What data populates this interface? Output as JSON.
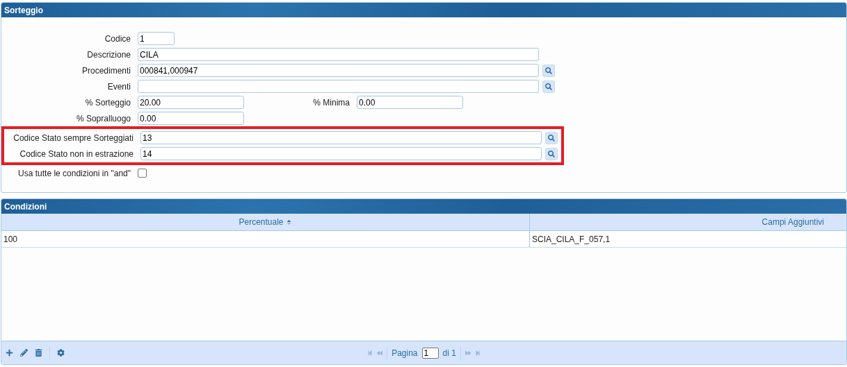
{
  "form_panel": {
    "title": "Sorteggio",
    "rows": [
      {
        "kind": "field",
        "fields": [
          {
            "kind": "short",
            "label": "Codice",
            "value": "1"
          }
        ]
      },
      {
        "kind": "field",
        "fields": [
          {
            "kind": "wide",
            "label": "Descrizione",
            "value": "CILA"
          }
        ]
      },
      {
        "kind": "field",
        "fields": [
          {
            "kind": "lookup",
            "label": "Procedimenti",
            "value": "000841,000947"
          }
        ]
      },
      {
        "kind": "field",
        "fields": [
          {
            "kind": "lookup",
            "label": "Eventi"
          }
        ]
      },
      {
        "kind": "field",
        "fields": [
          {
            "kind": "medium",
            "label": "% Sorteggio",
            "value": "20.00"
          },
          {
            "kind": "medium",
            "label": "% Minima",
            "value": "0.00"
          }
        ]
      },
      {
        "kind": "field",
        "fields": [
          {
            "kind": "medium",
            "label": "% Sopralluogo",
            "value": "0.00"
          }
        ]
      },
      {
        "kind": "highlight",
        "rows": [
          {
            "kind": "field",
            "fields": [
              {
                "kind": "lookup",
                "label": "Codice Stato sempre Sorteggiati",
                "value": "13"
              }
            ]
          },
          {
            "kind": "field",
            "fields": [
              {
                "kind": "lookup",
                "label": "Codice Stato non in estrazione",
                "value": "14"
              }
            ]
          }
        ]
      },
      {
        "kind": "checkbox",
        "label": "Usa tutte le condizioni in \"and\"",
        "checked": false
      }
    ]
  },
  "grid_panel": {
    "title": "Condizioni",
    "columns": [
      {
        "label": "Percentuale",
        "sorted": true
      },
      {
        "label": "Campi Aggiuntivi",
        "sorted": false
      }
    ],
    "rows": [
      [
        "100",
        "SCIA_CILA_F_057,1"
      ]
    ],
    "pager": {
      "label": "Pagina",
      "page": "1",
      "total": "di 1",
      "nav_disabled": true
    }
  }
}
